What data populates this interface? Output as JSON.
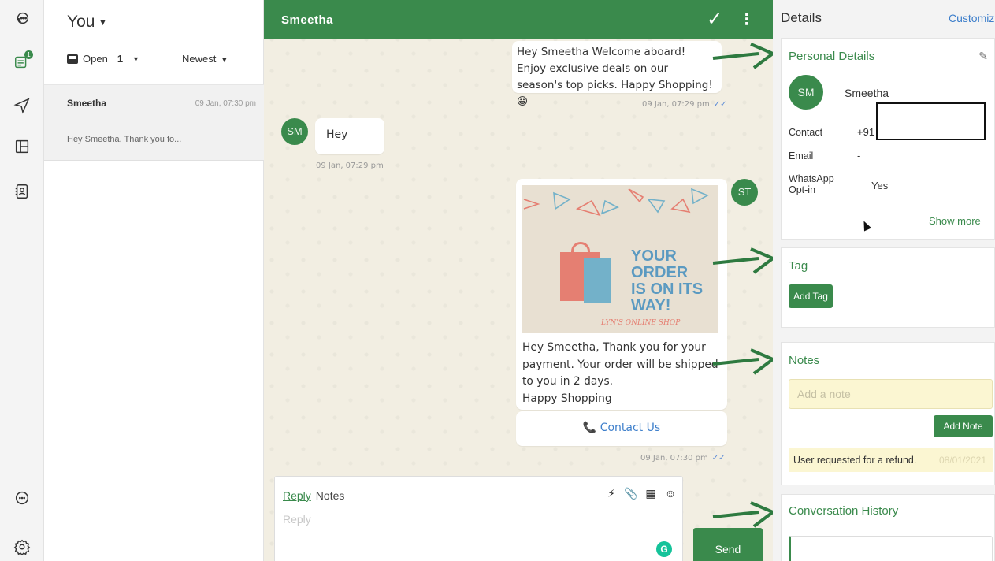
{
  "list": {
    "owner": "You",
    "filter_label": "Open",
    "filter_count": "1",
    "sort": "Newest",
    "conversations": [
      {
        "name": "Smeetha",
        "time": "09 Jan, 07:30 pm",
        "preview": "Hey Smeetha, Thank you fo..."
      }
    ]
  },
  "rail": {
    "badge": "1"
  },
  "chat": {
    "contact": "Smeetha",
    "messages": [
      {
        "text": "Hey Smeetha Welcome aboard! Enjoy exclusive deals on our season's top picks. Happy Shopping! 😀",
        "time": "09 Jan, 07:29 pm"
      },
      {
        "avatar": "SM",
        "text": "Hey",
        "time": "09 Jan, 07:29 pm"
      },
      {
        "avatar": "ST",
        "promo_line1": "YOUR ORDER",
        "promo_line2": "IS ON ITS",
        "promo_line3": "WAY!",
        "promo_shop": "LYN'S ONLINE SHOP",
        "line1": "Hey Smeetha, Thank you for your",
        "line2": "payment. Your order will be shipped",
        "line3": "to you in 2 days.",
        "line4": "Happy Shopping",
        "button": "Contact Us",
        "time": "09 Jan, 07:30 pm"
      }
    ]
  },
  "composer": {
    "tab_reply": "Reply",
    "tab_notes": "Notes",
    "placeholder": "Reply",
    "send": "Send",
    "grammarly": "G"
  },
  "details": {
    "title": "Details",
    "customize": "Customize",
    "personal": {
      "heading": "Personal Details",
      "initials": "SM",
      "name": "Smeetha",
      "contact_label": "Contact",
      "contact_value": "+91",
      "email_label": "Email",
      "email_value": "-",
      "optin_label_1": "WhatsApp",
      "optin_label_2": "Opt-in",
      "optin_value": "Yes",
      "show_more": "Show more"
    },
    "tag": {
      "heading": "Tag",
      "button": "Add Tag"
    },
    "notes": {
      "heading": "Notes",
      "placeholder": "Add a note",
      "button": "Add Note",
      "items": [
        {
          "text": "User requested for a refund.",
          "date": "08/01/2021"
        }
      ]
    },
    "history": {
      "heading": "Conversation History"
    }
  },
  "colors": {
    "brand": "#3a8a4c",
    "link": "#3e7fcb",
    "note_bg": "#fbf6d2",
    "chat_bg": "#f2eee2"
  }
}
